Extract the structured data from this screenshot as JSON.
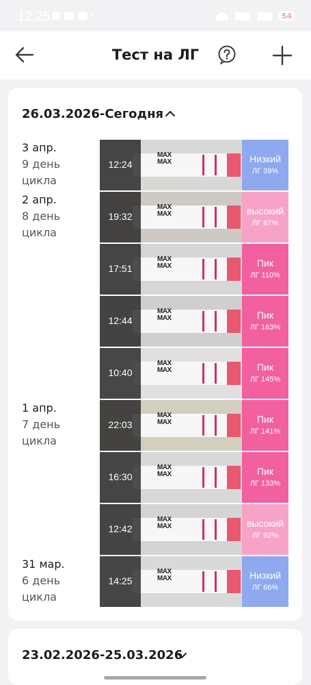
{
  "status": {
    "time": "12:25",
    "battery": "54"
  },
  "header": {
    "title": "Тест на ЛГ"
  },
  "colors": {
    "low": "#8ea9ee",
    "high": "#f7a3c8",
    "peak": "#f2609f"
  },
  "current_period": {
    "label": "26.03.2026-Сегодня"
  },
  "days": [
    {
      "date": "3 апр.",
      "cycle_line1": "9 день",
      "cycle_line2": "цикла"
    },
    {
      "date": "2 апр.",
      "cycle_line1": "8 день",
      "cycle_line2": "цикла"
    },
    {
      "date": "1 апр.",
      "cycle_line1": "7 день",
      "cycle_line2": "цикла"
    },
    {
      "date": "31 мар.",
      "cycle_line1": "6 день",
      "cycle_line2": "цикла"
    }
  ],
  "tests": [
    {
      "time": "12:24",
      "level": "Низкий",
      "lh": "ЛГ 39%",
      "kind": "low"
    },
    {
      "time": "19:32",
      "level": "высокий",
      "lh": "ЛГ 87%",
      "kind": "high"
    },
    {
      "time": "17:51",
      "level": "Пик",
      "lh": "ЛГ 110%",
      "kind": "peak"
    },
    {
      "time": "12:44",
      "level": "Пик",
      "lh": "ЛГ 163%",
      "kind": "peak"
    },
    {
      "time": "10:40",
      "level": "Пик",
      "lh": "ЛГ 145%",
      "kind": "peak"
    },
    {
      "time": "22:03",
      "level": "Пик",
      "lh": "ЛГ 141%",
      "kind": "peak"
    },
    {
      "time": "16:30",
      "level": "Пик",
      "lh": "ЛГ 133%",
      "kind": "peak"
    },
    {
      "time": "12:42",
      "level": "высокий",
      "lh": "ЛГ 92%",
      "kind": "high"
    },
    {
      "time": "14:25",
      "level": "Низкий",
      "lh": "ЛГ 66%",
      "kind": "low"
    }
  ],
  "previous_period": {
    "label": "23.02.2026-25.03.2026"
  },
  "icons": {
    "back": "arrow-left-icon",
    "help": "question-circle-icon",
    "add": "plus-icon",
    "collapse": "chevron-up-icon",
    "expand": "chevron-down-icon"
  }
}
